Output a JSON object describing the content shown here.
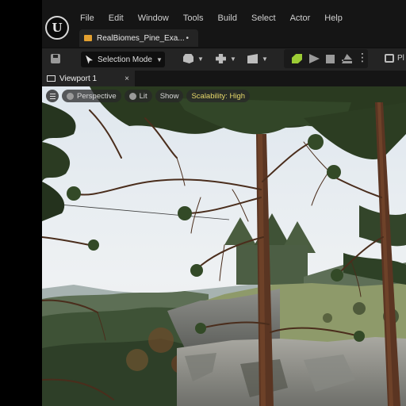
{
  "app": {
    "logo_letter": "U"
  },
  "menu": [
    "File",
    "Edit",
    "Window",
    "Tools",
    "Build",
    "Select",
    "Actor",
    "Help"
  ],
  "document_tab": {
    "label": "RealBiomes_Pine_Exa...",
    "modified_marker": "•"
  },
  "toolbar": {
    "selection_mode_label": "Selection Mode",
    "platforms_label": "Pl"
  },
  "viewport_tab": {
    "label": "Viewport 1",
    "close_glyph": "×"
  },
  "viewport_toolbar": {
    "perspective_label": "Perspective",
    "lit_label": "Lit",
    "show_label": "Show",
    "scalability_label": "Scalability: High"
  },
  "colors": {
    "scalability_text": "#e7d86a",
    "play_settings_accent": "#9ccc35",
    "document_tab_icon": "#e3a030"
  },
  "icons": {
    "logo": "unreal-logo",
    "save": "save-icon",
    "selection": "cursor-icon",
    "add_actor": "add-actor-icon",
    "blueprint": "blueprint-icon",
    "cinematics": "clapper-icon",
    "play_settings": "play-settings-icon",
    "play": "play-icon",
    "stop": "stop-icon",
    "eject": "eject-icon",
    "more": "more-vertical-icon",
    "platforms": "platforms-icon"
  }
}
